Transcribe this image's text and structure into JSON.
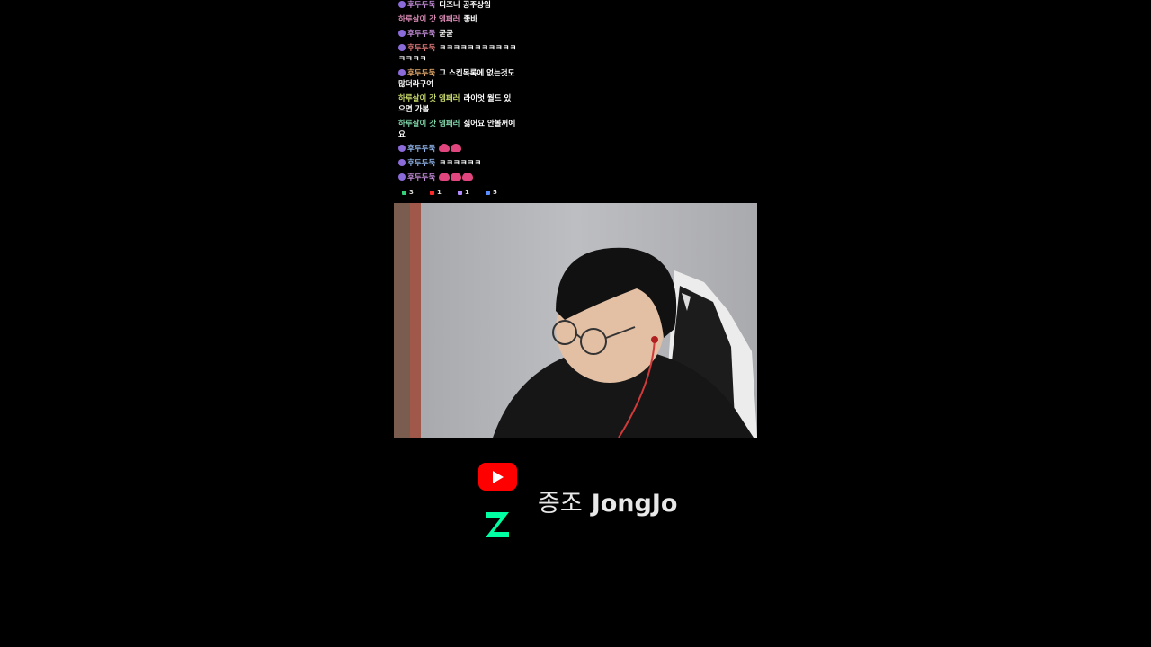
{
  "chat": {
    "messages": [
      {
        "badge": true,
        "nick": "후두두둑",
        "nick_color": "#c18bd6",
        "text": "디즈니 공주상임"
      },
      {
        "badge": false,
        "nick": "하루살이 갓 엠페러",
        "nick_color": "#d98ab5",
        "text": "좋바"
      },
      {
        "badge": true,
        "nick": "후두두둑",
        "nick_color": "#c18bd6",
        "text": "굳굳"
      },
      {
        "badge": true,
        "nick": "후두두둑",
        "nick_color": "#e07a7a",
        "text": "ㅋㅋㅋㅋㅋㅋㅋㅋㅋㅋㅋㅋㅋㅋㅋ"
      },
      {
        "badge": true,
        "nick": "후두두둑",
        "nick_color": "#e0a86b",
        "text": "그 스킨목록에 없는것도 많더라구여"
      },
      {
        "badge": false,
        "nick": "하루살이 갓 엠페러",
        "nick_color": "#c9d96b",
        "text": "라이엇 월드 있으면 가봄"
      },
      {
        "badge": false,
        "nick": "하루살이 갓 엠페러",
        "nick_color": "#7ed4a8",
        "text": "싫어요 안볼꺼예요"
      },
      {
        "badge": true,
        "nick": "후두두둑",
        "nick_color": "#8fb3e8",
        "text": "",
        "emotes": 2
      },
      {
        "badge": true,
        "nick": "후두두둑",
        "nick_color": "#8fb3e8",
        "text": "ㅋㅋㅋㅋㅋㅋ"
      },
      {
        "badge": true,
        "nick": "후두두둑",
        "nick_color": "#c18bd6",
        "text": "",
        "emotes": 3
      }
    ],
    "stats": [
      {
        "icon": "viewer-icon",
        "color": "#33d17a",
        "value": "3"
      },
      {
        "icon": "youtube-icon",
        "color": "#ff2b2b",
        "value": "1"
      },
      {
        "icon": "chat-icon",
        "color": "#b48bff",
        "value": "1"
      },
      {
        "icon": "emoji-icon",
        "color": "#5b8cff",
        "value": "5"
      }
    ]
  },
  "channel": {
    "korean_name": "종조",
    "english_name": "JongJo"
  },
  "colors": {
    "background": "#000000",
    "youtube_red": "#ff0000",
    "chzzk_green": "#00ffa3"
  }
}
